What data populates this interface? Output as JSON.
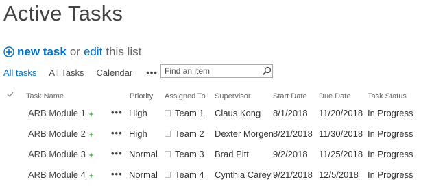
{
  "page": {
    "title": "Active Tasks"
  },
  "commands": {
    "new_task": "new task",
    "or": "or",
    "edit": "edit",
    "this_list": "this list"
  },
  "views": {
    "items": [
      "All tasks",
      "All Tasks",
      "Calendar"
    ],
    "more": "•••",
    "active_index": 0
  },
  "search": {
    "placeholder": "Find an item"
  },
  "table": {
    "headers": {
      "title": "Task Name",
      "priority": "Priority",
      "assigned": "Assigned To",
      "supervisor": "Supervisor",
      "start": "Start Date",
      "due": "Due Date",
      "status": "Task Status"
    },
    "rows": [
      {
        "title": "ARB Module 1",
        "priority": "High",
        "assigned": "Team 1",
        "supervisor": "Claus Kong",
        "start": "8/1/2018",
        "due": "11/20/2018",
        "status": "In Progress"
      },
      {
        "title": "ARB Module 2",
        "priority": "High",
        "assigned": "Team 2",
        "supervisor": "Dexter Morgen",
        "start": "8/21/2018",
        "due": "11/30/2018",
        "status": "In Progress"
      },
      {
        "title": "ARB Module 3",
        "priority": "Normal",
        "assigned": "Team 3",
        "supervisor": "Brad Pitt",
        "start": "9/2/2018",
        "due": "11/25/2018",
        "status": "In Progress"
      },
      {
        "title": "ARB Module 4",
        "priority": "Normal",
        "assigned": "Team 4",
        "supervisor": "Cynthia Carey",
        "start": "9/21/2018",
        "due": "12/5/2018",
        "status": "In Progress"
      }
    ],
    "row_menu": "•••"
  },
  "colors": {
    "accent": "#0072c6",
    "new_marker": "#4caf50"
  }
}
